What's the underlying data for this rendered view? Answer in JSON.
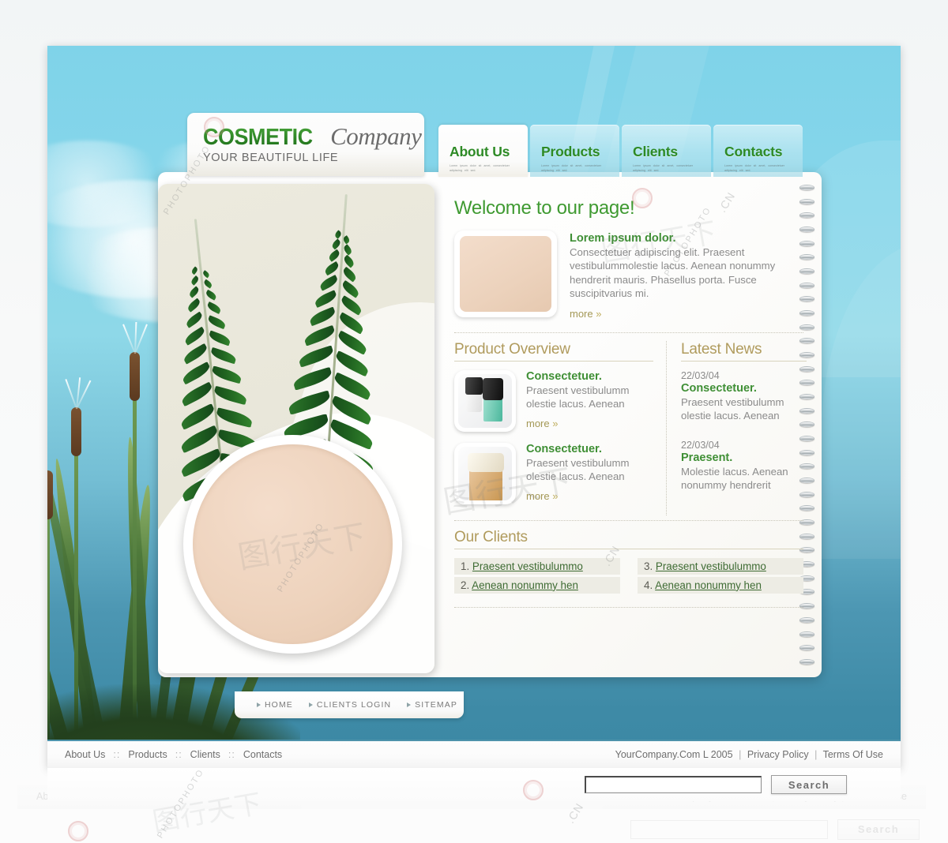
{
  "site": {
    "logo_primary": "COSMETIC",
    "logo_secondary": "Company",
    "tagline": "YOUR BEAUTIFUL LIFE"
  },
  "nav": {
    "tabs": [
      {
        "label": "About Us",
        "sub": "Lorem ipsum dolor sit amet, consectetuer adipiscing elit sed.",
        "active": true
      },
      {
        "label": "Products",
        "sub": "Lorem ipsum dolor sit amet, consectetuer adipiscing elit sed.",
        "active": false
      },
      {
        "label": "Clients",
        "sub": "Lorem ipsum dolor sit amet, consectetuer adipiscing elit sed.",
        "active": false
      },
      {
        "label": "Contacts",
        "sub": "Lorem ipsum dolor sit amet, consectetuer adipiscing elit sed.",
        "active": false
      }
    ]
  },
  "welcome": {
    "title": "Welcome to our page!",
    "lead": "Lorem ipsum dolor.",
    "body": "Consectetuer adipiscing elit. Praesent vestibulummolestie lacus. Aenean nonummy hendrerit mauris. Phasellus porta. Fusce suscipitvarius mi.",
    "more_label": "more"
  },
  "products": {
    "title": "Product Overview",
    "items": [
      {
        "title": "Consectetuer.",
        "desc": "Praesent vestibulumm olestie lacus. Aenean",
        "more_label": "more"
      },
      {
        "title": "Consectetuer.",
        "desc": "Praesent vestibulumm olestie lacus. Aenean",
        "more_label": "more"
      }
    ]
  },
  "news": {
    "title": "Latest News",
    "items": [
      {
        "date": "22/03/04",
        "title": "Consectetuer.",
        "desc": "Praesent vestibulumm olestie lacus. Aenean"
      },
      {
        "date": "22/03/04",
        "title": "Praesent.",
        "desc": "Molestie lacus. Aenean nonummy hendrerit"
      }
    ]
  },
  "clients": {
    "title": "Our Clients",
    "column_left": [
      {
        "num": "1.",
        "label": "Praesent vestibulummo"
      },
      {
        "num": "2.",
        "label": "Aenean nonummy hen"
      }
    ],
    "column_right": [
      {
        "num": "3.",
        "label": "Praesent vestibulummo"
      },
      {
        "num": "4.",
        "label": "Aenean nonummy hen"
      }
    ]
  },
  "mini_nav": {
    "items": [
      "HOME",
      "CLIENTS LOGIN",
      "SITEMAP"
    ]
  },
  "footer": {
    "links": [
      "About Us",
      "Products",
      "Clients",
      "Contacts"
    ],
    "separator": "::",
    "copyright": "YourCompany.Com L 2005",
    "privacy": "Privacy Policy",
    "terms": "Terms Of Use"
  },
  "search": {
    "value": "",
    "placeholder": "",
    "button_label": "Search"
  },
  "watermark": {
    "text": "PHOTOPHOTO",
    "cn": "图行天下",
    "domain": ".CN"
  },
  "colors": {
    "brand_green": "#2d8a25",
    "sky_blue": "#86d6ea",
    "accent_gold": "#b09b5d",
    "panel_beige": "#eceade",
    "cream": "#eed3bd"
  }
}
